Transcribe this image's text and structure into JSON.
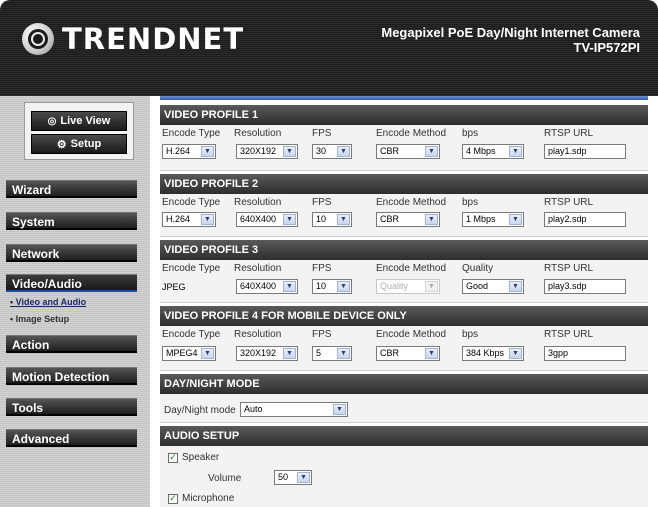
{
  "brand": {
    "logo_text": "TRENDNET"
  },
  "header": {
    "product_line": "Megapixel PoE Day/Night Internet Camera",
    "model": "TV-IP572PI"
  },
  "sidebar": {
    "live_view_label": "Live View",
    "setup_label": "Setup",
    "nav": [
      "Wizard",
      "System",
      "Network",
      "Video/Audio",
      "Action",
      "Motion Detection",
      "Tools",
      "Advanced"
    ],
    "sub_items": [
      "Video and Audio",
      "Image Setup"
    ]
  },
  "columns": {
    "encode_type": "Encode Type",
    "resolution": "Resolution",
    "fps": "FPS",
    "encode_method": "Encode Method",
    "bps": "bps",
    "quality": "Quality",
    "rtsp_url": "RTSP URL"
  },
  "profiles": [
    {
      "title": "VIDEO PROFILE 1",
      "encode_type": "H.264",
      "resolution": "320X192",
      "fps": "30",
      "encode_method": "CBR",
      "rate": "4 Mbps",
      "rtsp": "play1.sdp"
    },
    {
      "title": "VIDEO PROFILE 2",
      "encode_type": "H.264",
      "resolution": "640X400",
      "fps": "10",
      "encode_method": "CBR",
      "rate": "1 Mbps",
      "rtsp": "play2.sdp"
    },
    {
      "title": "VIDEO PROFILE 3",
      "encode_type": "JPEG",
      "resolution": "640X400",
      "fps": "10",
      "encode_method": "Quality",
      "rate": "Good",
      "rtsp": "play3.sdp"
    },
    {
      "title": "VIDEO PROFILE 4 FOR MOBILE DEVICE ONLY",
      "encode_type": "MPEG4",
      "resolution": "320X192",
      "fps": "5",
      "encode_method": "CBR",
      "rate": "384 Kbps",
      "rtsp": "3gpp"
    }
  ],
  "day_night": {
    "title": "DAY/NIGHT MODE",
    "label": "Day/Night mode",
    "value": "Auto"
  },
  "audio": {
    "title": "AUDIO SETUP",
    "speaker_label": "Speaker",
    "volume_label": "Volume",
    "volume_value": "50",
    "microphone_label": "Microphone"
  }
}
